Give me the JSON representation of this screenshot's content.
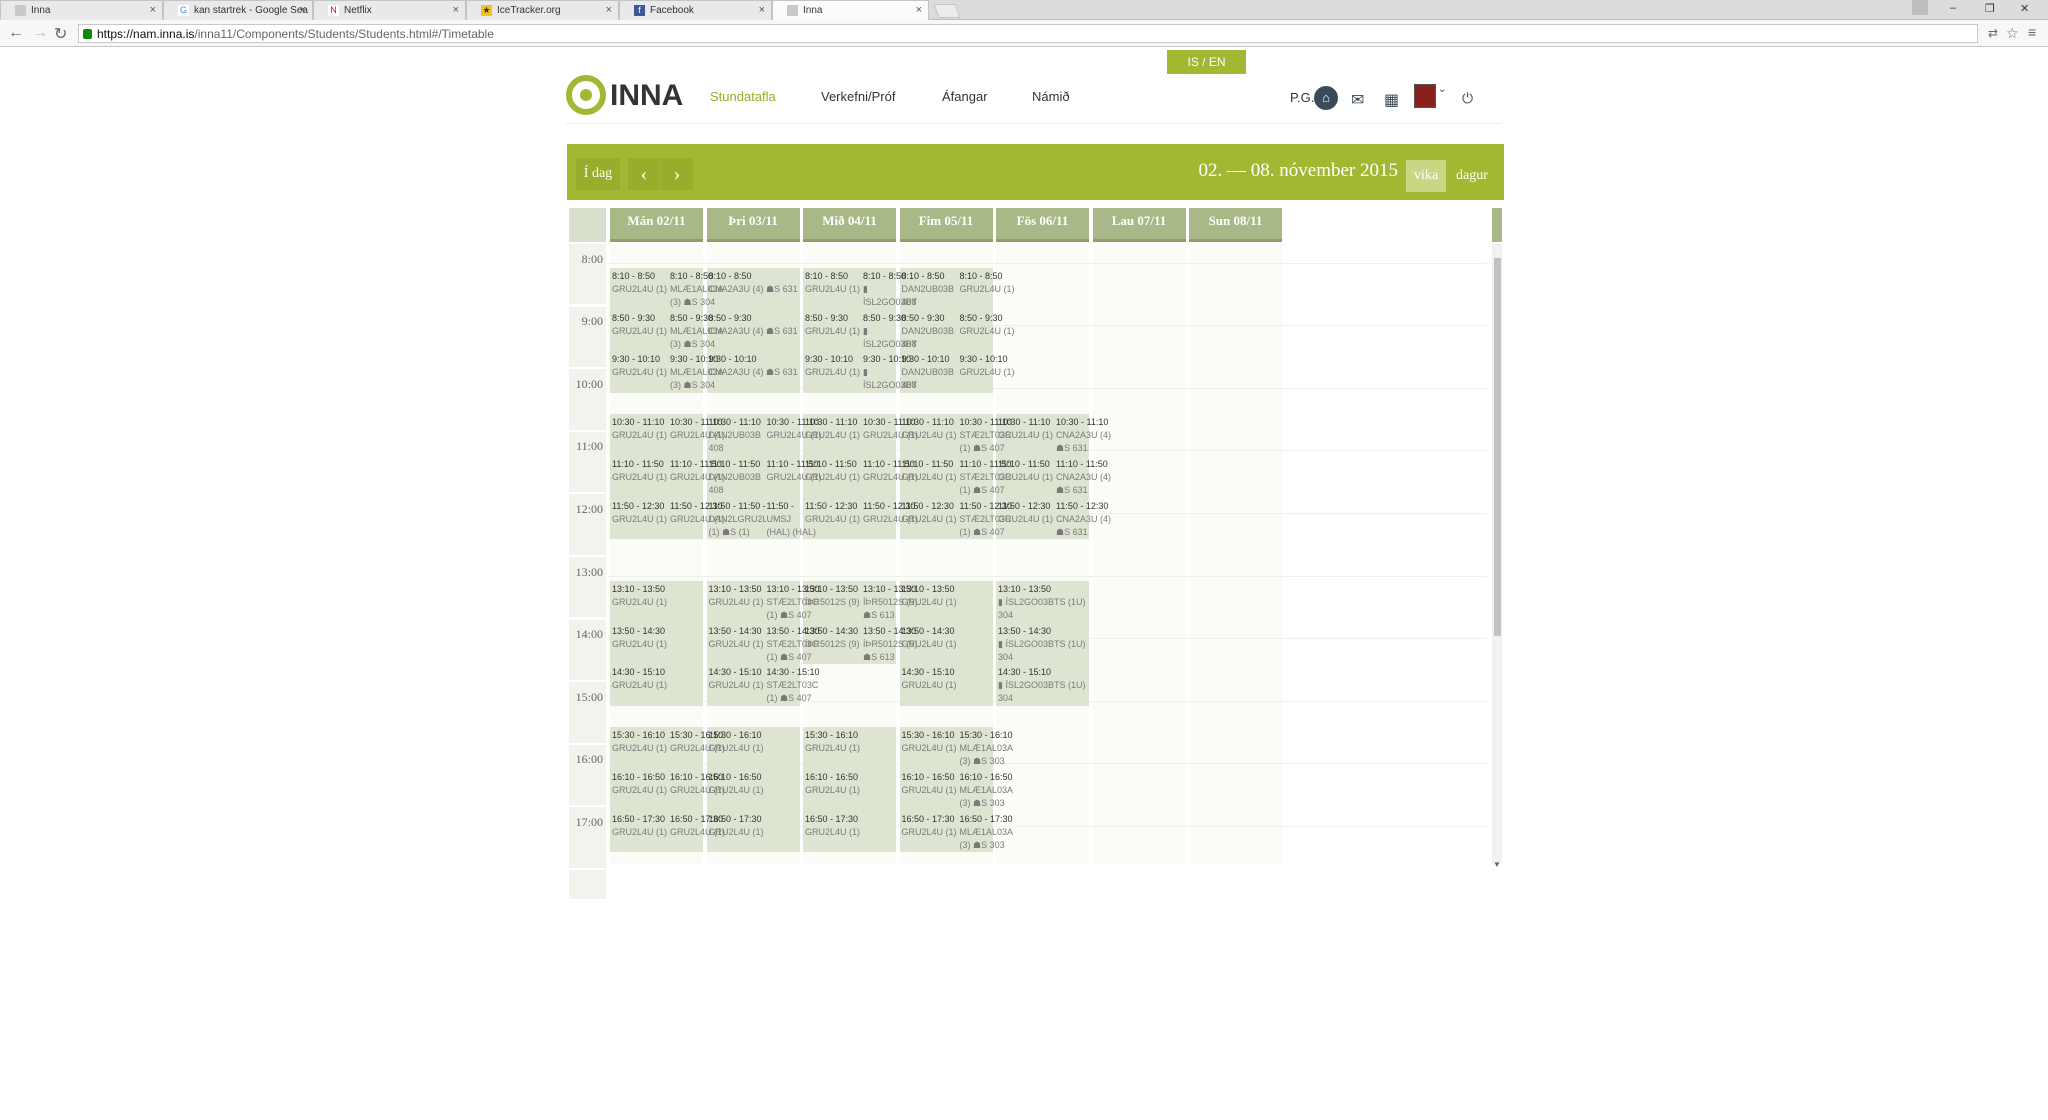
{
  "browser": {
    "tabs": [
      {
        "title": "Inna",
        "icon_color": "#c9c9c9",
        "glyph": ""
      },
      {
        "title": "kan startrek - Google Sea",
        "icon_color": "#4285f4",
        "glyph": "G"
      },
      {
        "title": "Netflix",
        "icon_color": "#e50914",
        "glyph": "N"
      },
      {
        "title": "IceTracker.org",
        "icon_color": "#f0c419",
        "glyph": "★"
      },
      {
        "title": "Facebook",
        "icon_color": "#3b5998",
        "glyph": "f"
      },
      {
        "title": "Inna",
        "icon_color": "#c9c9c9",
        "glyph": ""
      }
    ],
    "url_host": "https://nam.inna.is",
    "url_path": "/inna11/Components/Students/Students.html#/Timetable"
  },
  "header": {
    "lang": "IS / EN",
    "logo": "INNA",
    "nav": [
      "Stundatafla",
      "Verkefni/Próf",
      "Áfangar",
      "Námið"
    ],
    "user_initials": "P.G."
  },
  "toolbar": {
    "today": "Í dag",
    "prev": "‹",
    "next": "›",
    "date_range": "02. — 08. nóvember 2015",
    "views": [
      "vika",
      "dagur"
    ],
    "active_view": "vika"
  },
  "days": [
    "Mán 02/11",
    "Þri 03/11",
    "Mið 04/11",
    "Fim 05/11",
    "Fös 06/11",
    "Lau 07/11",
    "Sun 08/11"
  ],
  "hours": [
    "8:00",
    "9:00",
    "10:00",
    "11:00",
    "12:00",
    "13:00",
    "14:00",
    "15:00",
    "16:00",
    "17:00"
  ],
  "blocks": [
    {
      "day": 0,
      "start": "8:10",
      "end": "10:10"
    },
    {
      "day": 0,
      "start": "10:30",
      "end": "12:30"
    },
    {
      "day": 0,
      "start": "13:10",
      "end": "15:10"
    },
    {
      "day": 0,
      "start": "15:30",
      "end": "17:30"
    },
    {
      "day": 1,
      "start": "8:10",
      "end": "10:10"
    },
    {
      "day": 1,
      "start": "10:30",
      "end": "12:30"
    },
    {
      "day": 1,
      "start": "13:10",
      "end": "15:10"
    },
    {
      "day": 1,
      "start": "15:30",
      "end": "17:30"
    },
    {
      "day": 2,
      "start": "8:10",
      "end": "10:10"
    },
    {
      "day": 2,
      "start": "10:30",
      "end": "12:30"
    },
    {
      "day": 2,
      "start": "13:10",
      "end": "14:30"
    },
    {
      "day": 2,
      "start": "15:30",
      "end": "17:30"
    },
    {
      "day": 3,
      "start": "8:10",
      "end": "10:10"
    },
    {
      "day": 3,
      "start": "10:30",
      "end": "12:30"
    },
    {
      "day": 3,
      "start": "13:10",
      "end": "15:10"
    },
    {
      "day": 3,
      "start": "15:30",
      "end": "17:30"
    },
    {
      "day": 4,
      "start": "10:30",
      "end": "12:30"
    },
    {
      "day": 4,
      "start": "13:10",
      "end": "15:10"
    }
  ],
  "lessons": [
    {
      "day": 0,
      "col": 0,
      "start": "8:10",
      "time": "8:10 - 8:50",
      "name": "GRU2L4U (1)",
      "room": ""
    },
    {
      "day": 0,
      "col": 1,
      "start": "8:10",
      "time": "8:10 - 8:50",
      "name": "MLÆ1AL03A",
      "room": "(3) ☗S 304"
    },
    {
      "day": 0,
      "col": 0,
      "start": "8:50",
      "time": "8:50 - 9:30",
      "name": "GRU2L4U (1)",
      "room": ""
    },
    {
      "day": 0,
      "col": 1,
      "start": "8:50",
      "time": "8:50 - 9:30",
      "name": "MLÆ1AL03A",
      "room": "(3) ☗S 304"
    },
    {
      "day": 0,
      "col": 0,
      "start": "9:30",
      "time": "9:30 - 10:10",
      "name": "GRU2L4U (1)",
      "room": ""
    },
    {
      "day": 0,
      "col": 1,
      "start": "9:30",
      "time": "9:30 - 10:10",
      "name": "MLÆ1AL03A",
      "room": "(3) ☗S 304"
    },
    {
      "day": 0,
      "col": 0,
      "start": "10:30",
      "time": "10:30 - 11:10",
      "name": "GRU2L4U (1)",
      "room": ""
    },
    {
      "day": 0,
      "col": 1,
      "start": "10:30",
      "time": "10:30 - 11:10",
      "name": "GRU2L4U (1)",
      "room": ""
    },
    {
      "day": 0,
      "col": 0,
      "start": "11:10",
      "time": "11:10 - 11:50",
      "name": "GRU2L4U (1)",
      "room": ""
    },
    {
      "day": 0,
      "col": 1,
      "start": "11:10",
      "time": "11:10 - 11:50",
      "name": "GRU2L4U (1)",
      "room": ""
    },
    {
      "day": 0,
      "col": 0,
      "start": "11:50",
      "time": "11:50 - 12:30",
      "name": "GRU2L4U (1)",
      "room": ""
    },
    {
      "day": 0,
      "col": 1,
      "start": "11:50",
      "time": "11:50 - 12:30",
      "name": "GRU2L4U (1)",
      "room": ""
    },
    {
      "day": 0,
      "col": 0,
      "start": "13:10",
      "time": "13:10 - 13:50",
      "name": "GRU2L4U (1)",
      "room": ""
    },
    {
      "day": 0,
      "col": 0,
      "start": "13:50",
      "time": "13:50 - 14:30",
      "name": "GRU2L4U (1)",
      "room": ""
    },
    {
      "day": 0,
      "col": 0,
      "start": "14:30",
      "time": "14:30 - 15:10",
      "name": "GRU2L4U (1)",
      "room": ""
    },
    {
      "day": 0,
      "col": 0,
      "start": "15:30",
      "time": "15:30 - 16:10",
      "name": "GRU2L4U (1)",
      "room": ""
    },
    {
      "day": 0,
      "col": 1,
      "start": "15:30",
      "time": "15:30 - 16:10",
      "name": "GRU2L4U (1)",
      "room": ""
    },
    {
      "day": 0,
      "col": 0,
      "start": "16:10",
      "time": "16:10 - 16:50",
      "name": "GRU2L4U (1)",
      "room": ""
    },
    {
      "day": 0,
      "col": 1,
      "start": "16:10",
      "time": "16:10 - 16:50",
      "name": "GRU2L4U (1)",
      "room": ""
    },
    {
      "day": 0,
      "col": 0,
      "start": "16:50",
      "time": "16:50 - 17:30",
      "name": "GRU2L4U (1)",
      "room": ""
    },
    {
      "day": 0,
      "col": 1,
      "start": "16:50",
      "time": "16:50 - 17:30",
      "name": "GRU2L4U (1)",
      "room": ""
    },
    {
      "day": 1,
      "col": 0,
      "start": "8:10",
      "time": "8:10 - 8:50",
      "name": "CNA2A3U (4) ☗S 631",
      "room": ""
    },
    {
      "day": 1,
      "col": 0,
      "start": "8:50",
      "time": "8:50 - 9:30",
      "name": "CNA2A3U (4) ☗S 631",
      "room": ""
    },
    {
      "day": 1,
      "col": 0,
      "start": "9:30",
      "time": "9:30 - 10:10",
      "name": "CNA2A3U (4) ☗S 631",
      "room": ""
    },
    {
      "day": 1,
      "col": 0,
      "start": "10:30",
      "time": "10:30 - 11:10",
      "name": "DAN2UB03B",
      "room": "408"
    },
    {
      "day": 1,
      "col": 1,
      "start": "10:30",
      "time": "10:30 - 11:10",
      "name": "GRU2L4U (1)",
      "room": ""
    },
    {
      "day": 1,
      "col": 0,
      "start": "11:10",
      "time": "11:10 - 11:50",
      "name": "DAN2UB03B",
      "room": "408"
    },
    {
      "day": 1,
      "col": 1,
      "start": "11:10",
      "time": "11:10 - 11:50",
      "name": "GRU2L4U (1)",
      "room": ""
    },
    {
      "day": 1,
      "col": 0,
      "start": "11:50",
      "time": "11:50 - 11:50 -",
      "name": "DAN2LGRU2LUMSJ",
      "room": "(1) ☗S (1)"
    },
    {
      "day": 1,
      "col": 1,
      "start": "11:50",
      "time": "11:50 -",
      "name": "UMSJ",
      "room": "(HAL) (HAL)"
    },
    {
      "day": 1,
      "col": 0,
      "start": "13:10",
      "time": "13:10 - 13:50",
      "name": "GRU2L4U (1)",
      "room": ""
    },
    {
      "day": 1,
      "col": 1,
      "start": "13:10",
      "time": "13:10 - 13:50",
      "name": "STÆ2LT03C",
      "room": "(1) ☗S 407"
    },
    {
      "day": 1,
      "col": 0,
      "start": "13:50",
      "time": "13:50 - 14:30",
      "name": "GRU2L4U (1)",
      "room": ""
    },
    {
      "day": 1,
      "col": 1,
      "start": "13:50",
      "time": "13:50 - 14:30",
      "name": "STÆ2LT03C",
      "room": "(1) ☗S 407"
    },
    {
      "day": 1,
      "col": 0,
      "start": "14:30",
      "time": "14:30 - 15:10",
      "name": "GRU2L4U (1)",
      "room": ""
    },
    {
      "day": 1,
      "col": 1,
      "start": "14:30",
      "time": "14:30 - 15:10",
      "name": "STÆ2LT03C",
      "room": "(1) ☗S 407"
    },
    {
      "day": 1,
      "col": 0,
      "start": "15:30",
      "time": "15:30 - 16:10",
      "name": "GRU2L4U (1)",
      "room": ""
    },
    {
      "day": 1,
      "col": 0,
      "start": "16:10",
      "time": "16:10 - 16:50",
      "name": "GRU2L4U (1)",
      "room": ""
    },
    {
      "day": 1,
      "col": 0,
      "start": "16:50",
      "time": "16:50 - 17:30",
      "name": "GRU2L4U (1)",
      "room": ""
    },
    {
      "day": 2,
      "col": 0,
      "start": "8:10",
      "time": "8:10 - 8:50",
      "name": "GRU2L4U (1)",
      "room": ""
    },
    {
      "day": 2,
      "col": 1,
      "start": "8:10",
      "time": "8:10 - 8:50",
      "name": "▮",
      "room": "ÍSL2GO03BT"
    },
    {
      "day": 2,
      "col": 0,
      "start": "8:50",
      "time": "8:50 - 9:30",
      "name": "GRU2L4U (1)",
      "room": ""
    },
    {
      "day": 2,
      "col": 1,
      "start": "8:50",
      "time": "8:50 - 9:30",
      "name": "▮",
      "room": "ÍSL2GO03BT"
    },
    {
      "day": 2,
      "col": 0,
      "start": "9:30",
      "time": "9:30 - 10:10",
      "name": "GRU2L4U (1)",
      "room": ""
    },
    {
      "day": 2,
      "col": 1,
      "start": "9:30",
      "time": "9:30 - 10:10",
      "name": "▮",
      "room": "ÍSL2GO03BT"
    },
    {
      "day": 2,
      "col": 0,
      "start": "10:30",
      "time": "10:30 - 11:10",
      "name": "GRU2L4U (1)",
      "room": ""
    },
    {
      "day": 2,
      "col": 1,
      "start": "10:30",
      "time": "10:30 - 11:10",
      "name": "GRU2L4U (1)",
      "room": ""
    },
    {
      "day": 2,
      "col": 0,
      "start": "11:10",
      "time": "11:10 - 11:50",
      "name": "GRU2L4U (1)",
      "room": ""
    },
    {
      "day": 2,
      "col": 1,
      "start": "11:10",
      "time": "11:10 - 11:50",
      "name": "GRU2L4U (1)",
      "room": ""
    },
    {
      "day": 2,
      "col": 0,
      "start": "11:50",
      "time": "11:50 - 12:30",
      "name": "GRU2L4U (1)",
      "room": ""
    },
    {
      "day": 2,
      "col": 1,
      "start": "11:50",
      "time": "11:50 - 12:30",
      "name": "GRU2L4U (1)",
      "room": ""
    },
    {
      "day": 2,
      "col": 0,
      "start": "13:10",
      "time": "13:10 - 13:50",
      "name": "ÍÞR5012S (9)",
      "room": ""
    },
    {
      "day": 2,
      "col": 1,
      "start": "13:10",
      "time": "13:10 - 13:50",
      "name": "ÍÞR5012S (9)",
      "room": "☗S 613"
    },
    {
      "day": 2,
      "col": 0,
      "start": "13:50",
      "time": "13:50 - 14:30",
      "name": "ÍÞR5012S (9)",
      "room": ""
    },
    {
      "day": 2,
      "col": 1,
      "start": "13:50",
      "time": "13:50 - 14:30",
      "name": "ÍÞR5012S (9)",
      "room": "☗S 613"
    },
    {
      "day": 2,
      "col": 0,
      "start": "15:30",
      "time": "15:30 - 16:10",
      "name": "GRU2L4U (1)",
      "room": ""
    },
    {
      "day": 2,
      "col": 0,
      "start": "16:10",
      "time": "16:10 - 16:50",
      "name": "GRU2L4U (1)",
      "room": ""
    },
    {
      "day": 2,
      "col": 0,
      "start": "16:50",
      "time": "16:50 - 17:30",
      "name": "GRU2L4U (1)",
      "room": ""
    },
    {
      "day": 3,
      "col": 0,
      "start": "8:10",
      "time": "8:10 - 8:50",
      "name": "DAN2UB03B",
      "room": "408"
    },
    {
      "day": 3,
      "col": 1,
      "start": "8:10",
      "time": "8:10 - 8:50",
      "name": "GRU2L4U (1)",
      "room": ""
    },
    {
      "day": 3,
      "col": 0,
      "start": "8:50",
      "time": "8:50 - 9:30",
      "name": "DAN2UB03B",
      "room": "408"
    },
    {
      "day": 3,
      "col": 1,
      "start": "8:50",
      "time": "8:50 - 9:30",
      "name": "GRU2L4U (1)",
      "room": ""
    },
    {
      "day": 3,
      "col": 0,
      "start": "9:30",
      "time": "9:30 - 10:10",
      "name": "DAN2UB03B",
      "room": "408"
    },
    {
      "day": 3,
      "col": 1,
      "start": "9:30",
      "time": "9:30 - 10:10",
      "name": "GRU2L4U (1)",
      "room": ""
    },
    {
      "day": 3,
      "col": 0,
      "start": "10:30",
      "time": "10:30 - 11:10",
      "name": "GRU2L4U (1)",
      "room": ""
    },
    {
      "day": 3,
      "col": 1,
      "start": "10:30",
      "time": "10:30 - 11:10",
      "name": "STÆ2LT03C",
      "room": "(1) ☗S 407"
    },
    {
      "day": 3,
      "col": 0,
      "start": "11:10",
      "time": "11:10 - 11:50",
      "name": "GRU2L4U (1)",
      "room": ""
    },
    {
      "day": 3,
      "col": 1,
      "start": "11:10",
      "time": "11:10 - 11:50",
      "name": "STÆ2LT03C",
      "room": "(1) ☗S 407"
    },
    {
      "day": 3,
      "col": 0,
      "start": "11:50",
      "time": "11:50 - 12:30",
      "name": "GRU2L4U (1)",
      "room": ""
    },
    {
      "day": 3,
      "col": 1,
      "start": "11:50",
      "time": "11:50 - 12:30",
      "name": "STÆ2LT03C",
      "room": "(1) ☗S 407"
    },
    {
      "day": 3,
      "col": 0,
      "start": "13:10",
      "time": "13:10 - 13:50",
      "name": "GRU2L4U (1)",
      "room": ""
    },
    {
      "day": 3,
      "col": 0,
      "start": "13:50",
      "time": "13:50 - 14:30",
      "name": "GRU2L4U (1)",
      "room": ""
    },
    {
      "day": 3,
      "col": 0,
      "start": "14:30",
      "time": "14:30 - 15:10",
      "name": "GRU2L4U (1)",
      "room": ""
    },
    {
      "day": 3,
      "col": 0,
      "start": "15:30",
      "time": "15:30 - 16:10",
      "name": "GRU2L4U (1)",
      "room": ""
    },
    {
      "day": 3,
      "col": 1,
      "start": "15:30",
      "time": "15:30 - 16:10",
      "name": "MLÆ1AL03A",
      "room": "(3) ☗S 303"
    },
    {
      "day": 3,
      "col": 0,
      "start": "16:10",
      "time": "16:10 - 16:50",
      "name": "GRU2L4U (1)",
      "room": ""
    },
    {
      "day": 3,
      "col": 1,
      "start": "16:10",
      "time": "16:10 - 16:50",
      "name": "MLÆ1AL03A",
      "room": "(3) ☗S 303"
    },
    {
      "day": 3,
      "col": 0,
      "start": "16:50",
      "time": "16:50 - 17:30",
      "name": "GRU2L4U (1)",
      "room": ""
    },
    {
      "day": 3,
      "col": 1,
      "start": "16:50",
      "time": "16:50 - 17:30",
      "name": "MLÆ1AL03A",
      "room": "(3) ☗S 303"
    },
    {
      "day": 4,
      "col": 0,
      "start": "10:30",
      "time": "10:30 - 11:10",
      "name": "GRU2L4U (1)",
      "room": ""
    },
    {
      "day": 4,
      "col": 1,
      "start": "10:30",
      "time": "10:30 - 11:10",
      "name": "CNA2A3U (4)",
      "room": "☗S 631"
    },
    {
      "day": 4,
      "col": 0,
      "start": "11:10",
      "time": "11:10 - 11:50",
      "name": "GRU2L4U (1)",
      "room": ""
    },
    {
      "day": 4,
      "col": 1,
      "start": "11:10",
      "time": "11:10 - 11:50",
      "name": "CNA2A3U (4)",
      "room": "☗S 631"
    },
    {
      "day": 4,
      "col": 0,
      "start": "11:50",
      "time": "11:50 - 12:30",
      "name": "GRU2L4U (1)",
      "room": ""
    },
    {
      "day": 4,
      "col": 1,
      "start": "11:50",
      "time": "11:50 - 12:30",
      "name": "CNA2A3U (4)",
      "room": "☗S 631"
    },
    {
      "day": 4,
      "col": 0,
      "start": "13:10",
      "time": "13:10 - 13:50",
      "name": "▮ ÍSL2GO03BTS (1U) ☗S",
      "room": "304"
    },
    {
      "day": 4,
      "col": 0,
      "start": "13:50",
      "time": "13:50 - 14:30",
      "name": "▮ ÍSL2GO03BTS (1U) ☗S",
      "room": "304"
    },
    {
      "day": 4,
      "col": 0,
      "start": "14:30",
      "time": "14:30 - 15:10",
      "name": "▮ ÍSL2GO03BTS (1U) ☗S",
      "room": "304"
    }
  ]
}
